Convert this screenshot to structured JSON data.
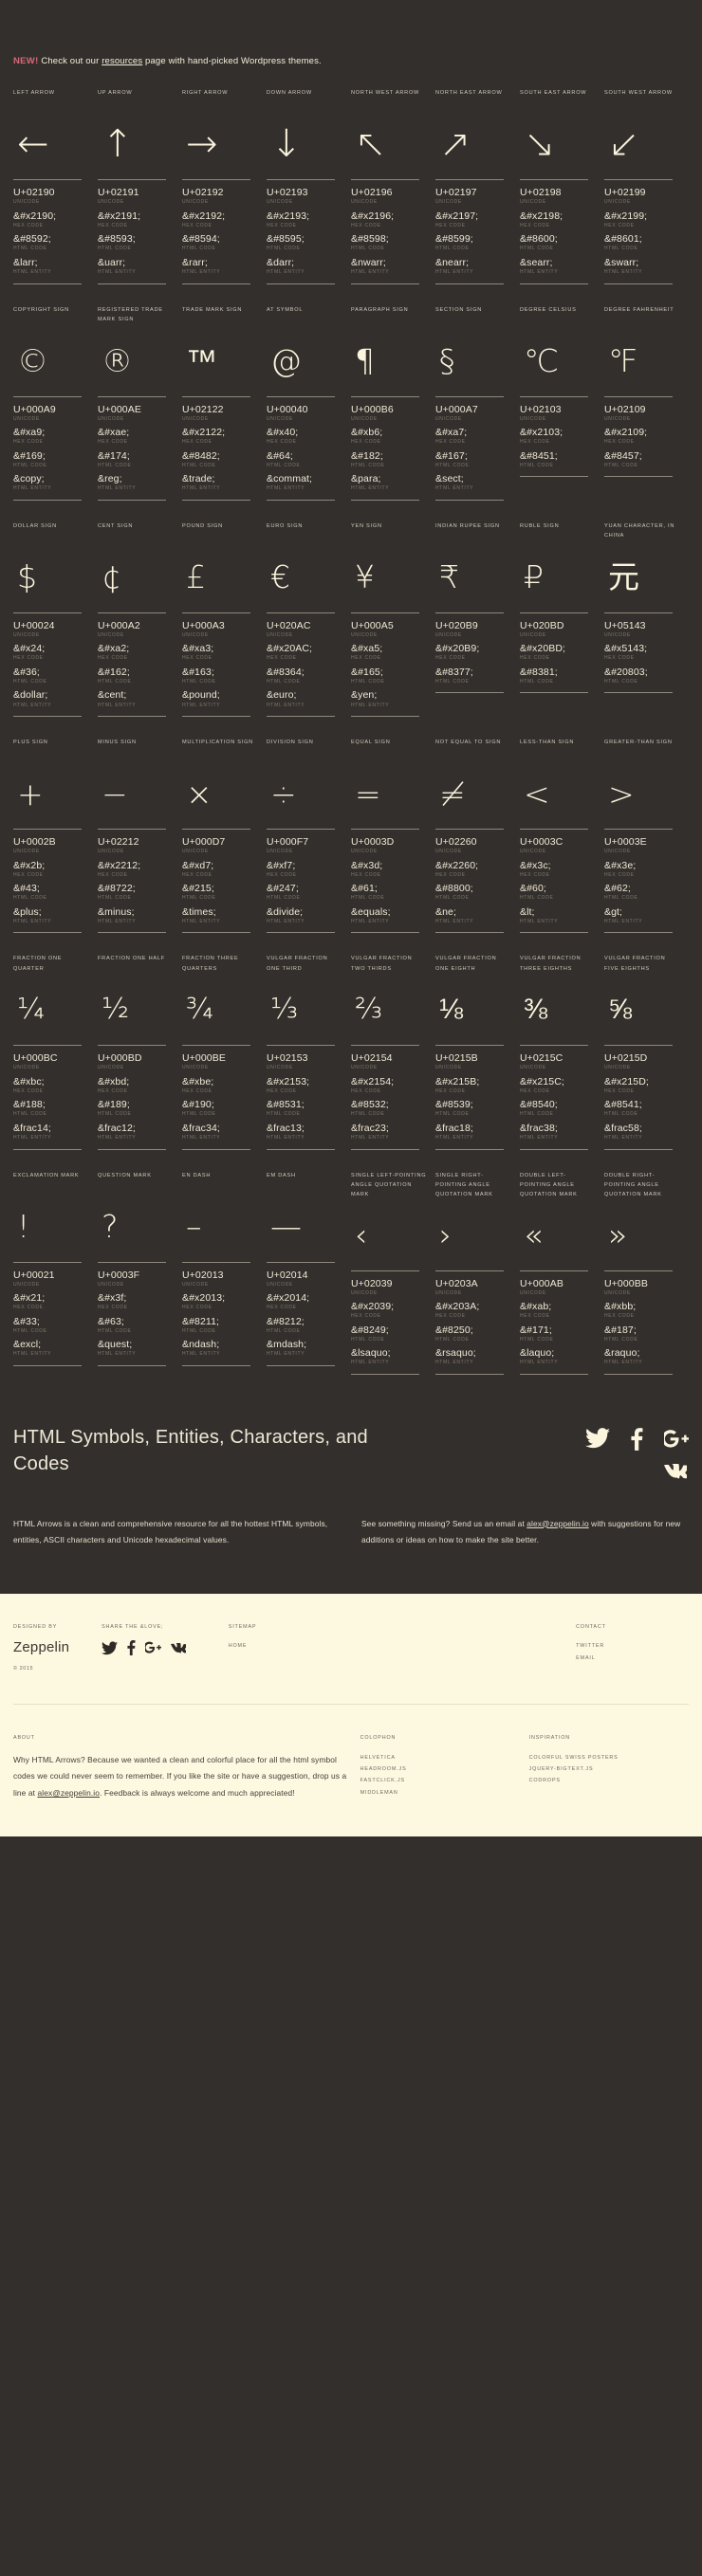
{
  "notice": {
    "badge": "NEW!",
    "text_before": " Check out our ",
    "link": "resources",
    "text_after": " page with hand-picked Wordpress themes."
  },
  "code_kinds": {
    "unicode": "UNICODE",
    "hex": "HEX CODE",
    "html": "HTML CODE",
    "entity": "HTML ENTITY"
  },
  "colors": {
    "background": "#332f2c",
    "glyph": "#fbf5de",
    "label": "#cfc9bb",
    "kind": "#7d776c",
    "accent_new": "#d9687a",
    "footer_bg": "#fdf8e0",
    "footer_text": "#6f6a60"
  },
  "rows": [
    {
      "name": "arrows",
      "cells": [
        {
          "label": "LEFT ARROW",
          "glyph": "←",
          "unicode": "U+02190",
          "hex": "&#x2190;",
          "html": "&#8592;",
          "entity": "&larr;"
        },
        {
          "label": "UP ARROW",
          "glyph": "↑",
          "unicode": "U+02191",
          "hex": "&#x2191;",
          "html": "&#8593;",
          "entity": "&uarr;"
        },
        {
          "label": "RIGHT ARROW",
          "glyph": "→",
          "unicode": "U+02192",
          "hex": "&#x2192;",
          "html": "&#8594;",
          "entity": "&rarr;"
        },
        {
          "label": "DOWN ARROW",
          "glyph": "↓",
          "unicode": "U+02193",
          "hex": "&#x2193;",
          "html": "&#8595;",
          "entity": "&darr;"
        },
        {
          "label": "NORTH WEST ARROW",
          "glyph": "↖",
          "unicode": "U+02196",
          "hex": "&#x2196;",
          "html": "&#8598;",
          "entity": "&nwarr;"
        },
        {
          "label": "NORTH EAST ARROW",
          "glyph": "↗",
          "unicode": "U+02197",
          "hex": "&#x2197;",
          "html": "&#8599;",
          "entity": "&nearr;"
        },
        {
          "label": "SOUTH EAST ARROW",
          "glyph": "↘",
          "unicode": "U+02198",
          "hex": "&#x2198;",
          "html": "&#8600;",
          "entity": "&searr;"
        },
        {
          "label": "SOUTH WEST ARROW",
          "glyph": "↙",
          "unicode": "U+02199",
          "hex": "&#x2199;",
          "html": "&#8601;",
          "entity": "&swarr;"
        }
      ]
    },
    {
      "name": "signs",
      "cells": [
        {
          "label": "COPYRIGHT SIGN",
          "glyph": "©",
          "unicode": "U+000A9",
          "hex": "&#xa9;",
          "html": "&#169;",
          "entity": "&copy;"
        },
        {
          "label": "REGISTERED TRADE MARK SIGN",
          "glyph": "®",
          "unicode": "U+000AE",
          "hex": "&#xae;",
          "html": "&#174;",
          "entity": "&reg;"
        },
        {
          "label": "TRADE MARK SIGN",
          "glyph": "™",
          "unicode": "U+02122",
          "hex": "&#x2122;",
          "html": "&#8482;",
          "entity": "&trade;"
        },
        {
          "label": "AT SYMBOL",
          "glyph": "@",
          "unicode": "U+00040",
          "hex": "&#x40;",
          "html": "&#64;",
          "entity": "&commat;"
        },
        {
          "label": "PARAGRAPH SIGN",
          "glyph": "¶",
          "unicode": "U+000B6",
          "hex": "&#xb6;",
          "html": "&#182;",
          "entity": "&para;"
        },
        {
          "label": "SECTION SIGN",
          "glyph": "§",
          "unicode": "U+000A7",
          "hex": "&#xa7;",
          "html": "&#167;",
          "entity": "&sect;"
        },
        {
          "label": "DEGREE CELSIUS",
          "glyph": "℃",
          "unicode": "U+02103",
          "hex": "&#x2103;",
          "html": "&#8451;",
          "entity": ""
        },
        {
          "label": "DEGREE FAHRENHEIT",
          "glyph": "℉",
          "unicode": "U+02109",
          "hex": "&#x2109;",
          "html": "&#8457;",
          "entity": ""
        }
      ]
    },
    {
      "name": "currency",
      "cells": [
        {
          "label": "DOLLAR SIGN",
          "glyph": "$",
          "unicode": "U+00024",
          "hex": "&#x24;",
          "html": "&#36;",
          "entity": "&dollar;"
        },
        {
          "label": "CENT SIGN",
          "glyph": "¢",
          "unicode": "U+000A2",
          "hex": "&#xa2;",
          "html": "&#162;",
          "entity": "&cent;"
        },
        {
          "label": "POUND SIGN",
          "glyph": "£",
          "unicode": "U+000A3",
          "hex": "&#xa3;",
          "html": "&#163;",
          "entity": "&pound;"
        },
        {
          "label": "EURO SIGN",
          "glyph": "€",
          "unicode": "U+020AC",
          "hex": "&#x20AC;",
          "html": "&#8364;",
          "entity": "&euro;"
        },
        {
          "label": "YEN SIGN",
          "glyph": "¥",
          "unicode": "U+000A5",
          "hex": "&#xa5;",
          "html": "&#165;",
          "entity": "&yen;"
        },
        {
          "label": "INDIAN RUPEE SIGN",
          "glyph": "₹",
          "unicode": "U+020B9",
          "hex": "&#x20B9;",
          "html": "&#8377;",
          "entity": ""
        },
        {
          "label": "RUBLE SIGN",
          "glyph": "₽",
          "unicode": "U+020BD",
          "hex": "&#x20BD;",
          "html": "&#8381;",
          "entity": ""
        },
        {
          "label": "YUAN CHARACTER, IN CHINA",
          "glyph": "元",
          "unicode": "U+05143",
          "hex": "&#x5143;",
          "html": "&#20803;",
          "entity": ""
        }
      ]
    },
    {
      "name": "math",
      "cells": [
        {
          "label": "PLUS SIGN",
          "glyph": "+",
          "unicode": "U+0002B",
          "hex": "&#x2b;",
          "html": "&#43;",
          "entity": "&plus;"
        },
        {
          "label": "MINUS SIGN",
          "glyph": "−",
          "unicode": "U+02212",
          "hex": "&#x2212;",
          "html": "&#8722;",
          "entity": "&minus;"
        },
        {
          "label": "MULTIPLICATION SIGN",
          "glyph": "×",
          "unicode": "U+000D7",
          "hex": "&#xd7;",
          "html": "&#215;",
          "entity": "&times;"
        },
        {
          "label": "DIVISION SIGN",
          "glyph": "÷",
          "unicode": "U+000F7",
          "hex": "&#xf7;",
          "html": "&#247;",
          "entity": "&divide;"
        },
        {
          "label": "EQUAL SIGN",
          "glyph": "=",
          "unicode": "U+0003D",
          "hex": "&#x3d;",
          "html": "&#61;",
          "entity": "&equals;"
        },
        {
          "label": "NOT EQUAL TO SIGN",
          "glyph": "≠",
          "unicode": "U+02260",
          "hex": "&#x2260;",
          "html": "&#8800;",
          "entity": "&ne;"
        },
        {
          "label": "LESS-THAN SIGN",
          "glyph": "<",
          "unicode": "U+0003C",
          "hex": "&#x3c;",
          "html": "&#60;",
          "entity": "&lt;"
        },
        {
          "label": "GREATER-THAN SIGN",
          "glyph": ">",
          "unicode": "U+0003E",
          "hex": "&#x3e;",
          "html": "&#62;",
          "entity": "&gt;"
        }
      ]
    },
    {
      "name": "fractions",
      "cells": [
        {
          "label": "FRACTION ONE QUARTER",
          "glyph": "¼",
          "unicode": "U+000BC",
          "hex": "&#xbc;",
          "html": "&#188;",
          "entity": "&frac14;"
        },
        {
          "label": "FRACTION ONE HALF",
          "glyph": "½",
          "unicode": "U+000BD",
          "hex": "&#xbd;",
          "html": "&#189;",
          "entity": "&frac12;"
        },
        {
          "label": "FRACTION THREE QUARTERS",
          "glyph": "¾",
          "unicode": "U+000BE",
          "hex": "&#xbe;",
          "html": "&#190;",
          "entity": "&frac34;"
        },
        {
          "label": "VULGAR FRACTION ONE THIRD",
          "glyph": "⅓",
          "unicode": "U+02153",
          "hex": "&#x2153;",
          "html": "&#8531;",
          "entity": "&frac13;"
        },
        {
          "label": "VULGAR FRACTION TWO THIRDS",
          "glyph": "⅔",
          "unicode": "U+02154",
          "hex": "&#x2154;",
          "html": "&#8532;",
          "entity": "&frac23;"
        },
        {
          "label": "VULGAR FRACTION ONE EIGHTH",
          "glyph": "⅛",
          "unicode": "U+0215B",
          "hex": "&#x215B;",
          "html": "&#8539;",
          "entity": "&frac18;"
        },
        {
          "label": "VULGAR FRACTION THREE EIGHTHS",
          "glyph": "⅜",
          "unicode": "U+0215C",
          "hex": "&#x215C;",
          "html": "&#8540;",
          "entity": "&frac38;"
        },
        {
          "label": "VULGAR FRACTION FIVE EIGHTHS",
          "glyph": "⅝",
          "unicode": "U+0215D",
          "hex": "&#x215D;",
          "html": "&#8541;",
          "entity": "&frac58;"
        }
      ]
    },
    {
      "name": "punctuation",
      "cells": [
        {
          "label": "EXCLAMATION MARK",
          "glyph": "!",
          "unicode": "U+00021",
          "hex": "&#x21;",
          "html": "&#33;",
          "entity": "&excl;"
        },
        {
          "label": "QUESTION MARK",
          "glyph": "?",
          "unicode": "U+0003F",
          "hex": "&#x3f;",
          "html": "&#63;",
          "entity": "&quest;"
        },
        {
          "label": "EN DASH",
          "glyph": "–",
          "unicode": "U+02013",
          "hex": "&#x2013;",
          "html": "&#8211;",
          "entity": "&ndash;"
        },
        {
          "label": "EM DASH",
          "glyph": "—",
          "unicode": "U+02014",
          "hex": "&#x2014;",
          "html": "&#8212;",
          "entity": "&mdash;"
        },
        {
          "label": "SINGLE LEFT-POINTING ANGLE QUOTATION MARK",
          "glyph": "‹",
          "unicode": "U+02039",
          "hex": "&#x2039;",
          "html": "&#8249;",
          "entity": "&lsaquo;"
        },
        {
          "label": "SINGLE RIGHT-POINTING ANGLE QUOTATION MARK",
          "glyph": "›",
          "unicode": "U+0203A",
          "hex": "&#x203A;",
          "html": "&#8250;",
          "entity": "&rsaquo;"
        },
        {
          "label": "DOUBLE LEFT-POINTING ANGLE QUOTATION MARK",
          "glyph": "«",
          "unicode": "U+000AB",
          "hex": "&#xab;",
          "html": "&#171;",
          "entity": "&laquo;"
        },
        {
          "label": "DOUBLE RIGHT-POINTING ANGLE QUOTATION MARK",
          "glyph": "»",
          "unicode": "U+000BB",
          "hex": "&#xbb;",
          "html": "&#187;",
          "entity": "&raquo;"
        }
      ]
    }
  ],
  "about": {
    "title": "HTML Symbols, Entities, Characters, and Codes",
    "left_text": "HTML Arrows is a clean and comprehensive resource for all the hottest HTML symbols, entities, ASCII characters and Unicode hexadecimal values.",
    "right_before": "See something missing? Send us an email at ",
    "right_link": "alex@zeppelin.io",
    "right_after": " with suggestions for new additions or ideas on how to make the site better.",
    "social": [
      "twitter-icon",
      "facebook-icon",
      "google-plus-icon",
      "vk-icon"
    ]
  },
  "footer": {
    "designed_by_head": "DESIGNED BY",
    "brand": "Zeppelin",
    "copyright": "© 2015",
    "share_head": "SHARE THE &love;",
    "sitemap_head": "SITEMAP",
    "sitemap_links": [
      "HOME"
    ],
    "contact_head": "CONTACT",
    "contact_links": [
      "TWITTER",
      "EMAIL"
    ],
    "about_head": "ABOUT",
    "about_before": "Why HTML Arrows? Because we wanted a clean and colorful place for all the html symbol codes we could never seem to remember. If you like the site or have a suggestion, drop us a line at ",
    "about_link": "alex@zeppelin.io",
    "about_after": ". Feedback is always welcome and much appreciated!",
    "colophon_head": "COLOPHON",
    "colophon_links": [
      "HELVETICA",
      "HEADROOM.JS",
      "FASTCLICK.JS",
      "MIDDLEMAN"
    ],
    "inspiration_head": "INSPIRATION",
    "inspiration_links": [
      "COLORFUL SWISS POSTERS",
      "JQUERY-BIGTEXT.JS",
      "CODROPS"
    ]
  }
}
